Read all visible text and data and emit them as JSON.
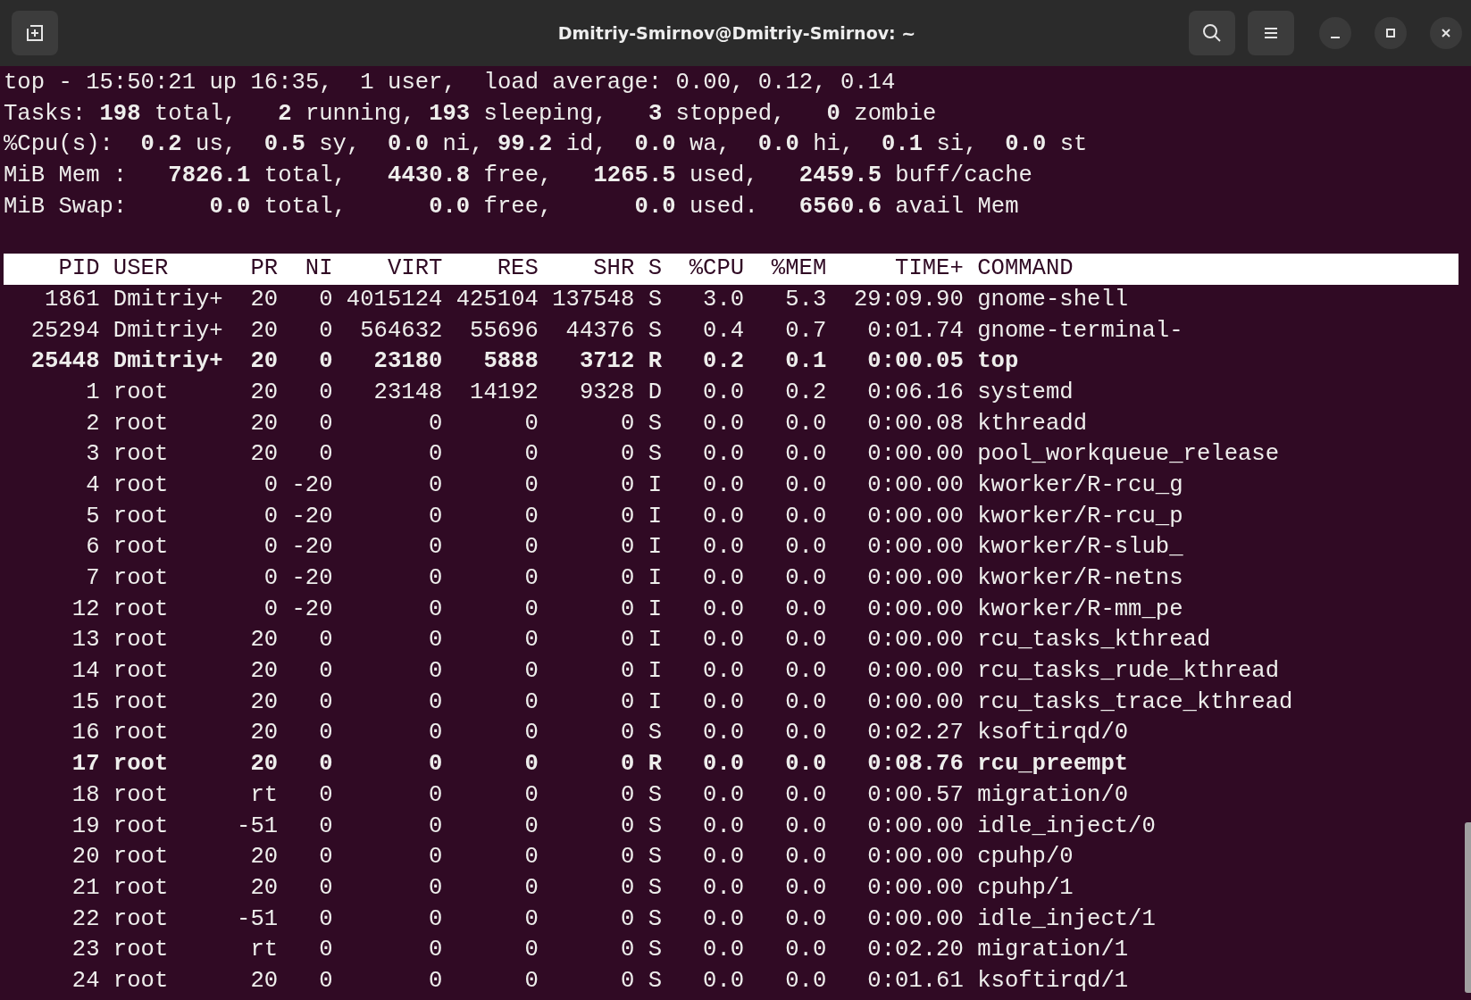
{
  "window": {
    "title": "Dmitriy-Smirnov@Dmitriy-Smirnov: ~"
  },
  "summary": [
    "top - 15:50:21 up 16:35,  1 user,  load average: 0.00, 0.12, 0.14",
    "Tasks: **198** total,   **2** running, **193** sleeping,   **3** stopped,   **0** zombie",
    "%Cpu(s):  **0.2** us,  **0.5** sy,  **0.0** ni, **99.2** id,  **0.0** wa,  **0.0** hi,  **0.1** si,  **0.0** st",
    "MiB Mem :   **7826.1** total,   **4430.8** free,   **1265.5** used,   **2459.5** buff/cache",
    "MiB Swap:      **0.0** total,      **0.0** free,      **0.0** used.   **6560.6** avail Mem"
  ],
  "table": {
    "columns": [
      "PID",
      "USER",
      "PR",
      "NI",
      "VIRT",
      "RES",
      "SHR",
      "S",
      "%CPU",
      "%MEM",
      "TIME+",
      "COMMAND"
    ],
    "rows": [
      {
        "cells": [
          "1861",
          "Dmitriy+",
          "20",
          "0",
          "4015124",
          "425104",
          "137548",
          "S",
          "3.0",
          "5.3",
          "29:09.90",
          "gnome-shell"
        ],
        "highlighted": false
      },
      {
        "cells": [
          "25294",
          "Dmitriy+",
          "20",
          "0",
          "564632",
          "55696",
          "44376",
          "S",
          "0.4",
          "0.7",
          "0:01.74",
          "gnome-terminal-"
        ],
        "highlighted": false
      },
      {
        "cells": [
          "25448",
          "Dmitriy+",
          "20",
          "0",
          "23180",
          "5888",
          "3712",
          "R",
          "0.2",
          "0.1",
          "0:00.05",
          "top"
        ],
        "highlighted": true
      },
      {
        "cells": [
          "1",
          "root",
          "20",
          "0",
          "23148",
          "14192",
          "9328",
          "D",
          "0.0",
          "0.2",
          "0:06.16",
          "systemd"
        ],
        "highlighted": false
      },
      {
        "cells": [
          "2",
          "root",
          "20",
          "0",
          "0",
          "0",
          "0",
          "S",
          "0.0",
          "0.0",
          "0:00.08",
          "kthreadd"
        ],
        "highlighted": false
      },
      {
        "cells": [
          "3",
          "root",
          "20",
          "0",
          "0",
          "0",
          "0",
          "S",
          "0.0",
          "0.0",
          "0:00.00",
          "pool_workqueue_release"
        ],
        "highlighted": false
      },
      {
        "cells": [
          "4",
          "root",
          "0",
          "-20",
          "0",
          "0",
          "0",
          "I",
          "0.0",
          "0.0",
          "0:00.00",
          "kworker/R-rcu_g"
        ],
        "highlighted": false
      },
      {
        "cells": [
          "5",
          "root",
          "0",
          "-20",
          "0",
          "0",
          "0",
          "I",
          "0.0",
          "0.0",
          "0:00.00",
          "kworker/R-rcu_p"
        ],
        "highlighted": false
      },
      {
        "cells": [
          "6",
          "root",
          "0",
          "-20",
          "0",
          "0",
          "0",
          "I",
          "0.0",
          "0.0",
          "0:00.00",
          "kworker/R-slub_"
        ],
        "highlighted": false
      },
      {
        "cells": [
          "7",
          "root",
          "0",
          "-20",
          "0",
          "0",
          "0",
          "I",
          "0.0",
          "0.0",
          "0:00.00",
          "kworker/R-netns"
        ],
        "highlighted": false
      },
      {
        "cells": [
          "12",
          "root",
          "0",
          "-20",
          "0",
          "0",
          "0",
          "I",
          "0.0",
          "0.0",
          "0:00.00",
          "kworker/R-mm_pe"
        ],
        "highlighted": false
      },
      {
        "cells": [
          "13",
          "root",
          "20",
          "0",
          "0",
          "0",
          "0",
          "I",
          "0.0",
          "0.0",
          "0:00.00",
          "rcu_tasks_kthread"
        ],
        "highlighted": false
      },
      {
        "cells": [
          "14",
          "root",
          "20",
          "0",
          "0",
          "0",
          "0",
          "I",
          "0.0",
          "0.0",
          "0:00.00",
          "rcu_tasks_rude_kthread"
        ],
        "highlighted": false
      },
      {
        "cells": [
          "15",
          "root",
          "20",
          "0",
          "0",
          "0",
          "0",
          "I",
          "0.0",
          "0.0",
          "0:00.00",
          "rcu_tasks_trace_kthread"
        ],
        "highlighted": false
      },
      {
        "cells": [
          "16",
          "root",
          "20",
          "0",
          "0",
          "0",
          "0",
          "S",
          "0.0",
          "0.0",
          "0:02.27",
          "ksoftirqd/0"
        ],
        "highlighted": false
      },
      {
        "cells": [
          "17",
          "root",
          "20",
          "0",
          "0",
          "0",
          "0",
          "R",
          "0.0",
          "0.0",
          "0:08.76",
          "rcu_preempt"
        ],
        "highlighted": true
      },
      {
        "cells": [
          "18",
          "root",
          "rt",
          "0",
          "0",
          "0",
          "0",
          "S",
          "0.0",
          "0.0",
          "0:00.57",
          "migration/0"
        ],
        "highlighted": false
      },
      {
        "cells": [
          "19",
          "root",
          "-51",
          "0",
          "0",
          "0",
          "0",
          "S",
          "0.0",
          "0.0",
          "0:00.00",
          "idle_inject/0"
        ],
        "highlighted": false
      },
      {
        "cells": [
          "20",
          "root",
          "20",
          "0",
          "0",
          "0",
          "0",
          "S",
          "0.0",
          "0.0",
          "0:00.00",
          "cpuhp/0"
        ],
        "highlighted": false
      },
      {
        "cells": [
          "21",
          "root",
          "20",
          "0",
          "0",
          "0",
          "0",
          "S",
          "0.0",
          "0.0",
          "0:00.00",
          "cpuhp/1"
        ],
        "highlighted": false
      },
      {
        "cells": [
          "22",
          "root",
          "-51",
          "0",
          "0",
          "0",
          "0",
          "S",
          "0.0",
          "0.0",
          "0:00.00",
          "idle_inject/1"
        ],
        "highlighted": false
      },
      {
        "cells": [
          "23",
          "root",
          "rt",
          "0",
          "0",
          "0",
          "0",
          "S",
          "0.0",
          "0.0",
          "0:02.20",
          "migration/1"
        ],
        "highlighted": false
      },
      {
        "cells": [
          "24",
          "root",
          "20",
          "0",
          "0",
          "0",
          "0",
          "S",
          "0.0",
          "0.0",
          "0:01.61",
          "ksoftirqd/1"
        ],
        "highlighted": false
      }
    ]
  }
}
